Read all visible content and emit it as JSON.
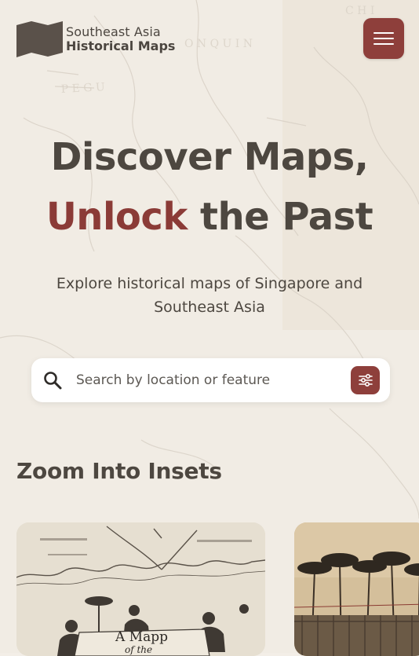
{
  "brand": {
    "line1": "Southeast Asia",
    "line2": "Historical Maps"
  },
  "hero": {
    "line1": "Discover Maps,",
    "accent_word": "Unlock",
    "line2_rest": " the Past"
  },
  "subtitle": "Explore historical maps of Singapore and Southeast Asia",
  "search": {
    "placeholder": "Search by location or feature"
  },
  "section": {
    "title": "Zoom Into Insets"
  },
  "cards": [
    {
      "caption_line1": "A Mapp",
      "caption_line2": "of the"
    }
  ],
  "icons": {
    "menu": "hamburger-icon",
    "search": "search-icon",
    "filter": "sliders-icon",
    "logo": "folded-map-logo"
  },
  "colors": {
    "accent": "#8e3f3b",
    "text": "#4d4740",
    "background": "#f3eee7"
  }
}
